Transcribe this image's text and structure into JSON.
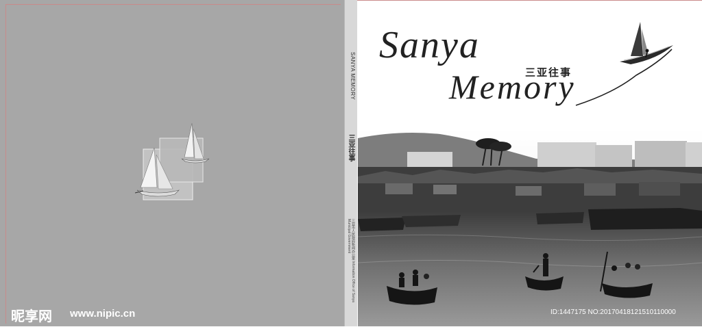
{
  "spine": {
    "title_en": "SANYA MEMORY",
    "title_cn": "三亚往事",
    "publisher": "三亚市人民政府新闻办公室 Information Office of Sanya Municipal Government"
  },
  "front": {
    "title_line1": "Sanya",
    "title_line2": "Memory",
    "title_cn": "三亚往事"
  },
  "watermark": {
    "logo": "昵享网",
    "url": "www.nipic.cn",
    "id": "ID:1447175 NO:20170418121510110000"
  },
  "icons": [
    "sailboat-icon",
    "windsurfer-icon"
  ]
}
